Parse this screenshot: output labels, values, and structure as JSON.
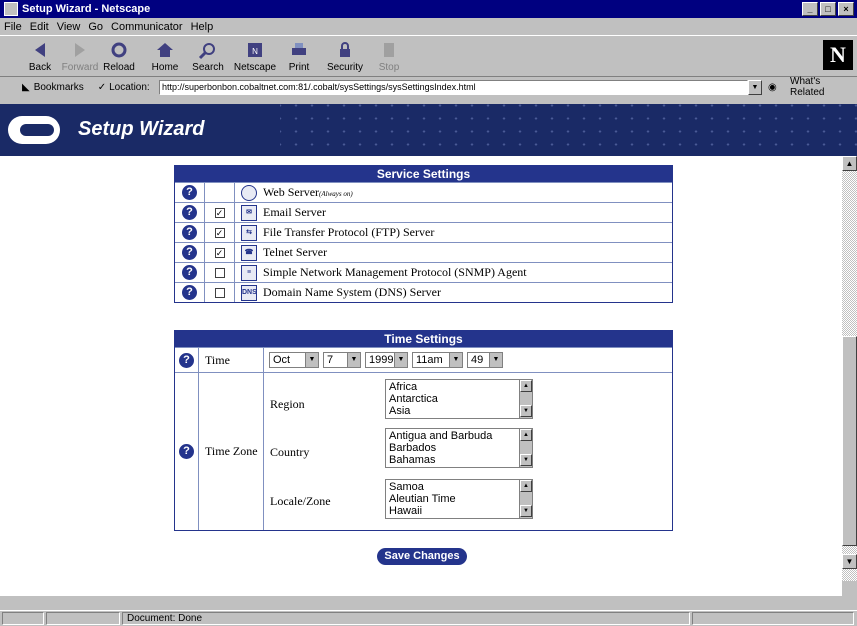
{
  "window": {
    "title": "Setup Wizard - Netscape"
  },
  "menu": [
    "File",
    "Edit",
    "View",
    "Go",
    "Communicator",
    "Help"
  ],
  "toolbar": [
    {
      "label": "Back",
      "icon": "back-arrow-icon",
      "enabled": true
    },
    {
      "label": "Forward",
      "icon": "forward-arrow-icon",
      "enabled": false
    },
    {
      "label": "Reload",
      "icon": "reload-icon",
      "enabled": true
    },
    {
      "label": "Home",
      "icon": "home-icon",
      "enabled": true
    },
    {
      "label": "Search",
      "icon": "search-icon",
      "enabled": true
    },
    {
      "label": "Netscape",
      "icon": "netscape-icon",
      "enabled": true
    },
    {
      "label": "Print",
      "icon": "print-icon",
      "enabled": true
    },
    {
      "label": "Security",
      "icon": "lock-icon",
      "enabled": true
    },
    {
      "label": "Stop",
      "icon": "stop-icon",
      "enabled": false
    }
  ],
  "location": {
    "bookmarks_label": "Bookmarks",
    "location_label": "Location:",
    "url": "http://superbonbon.cobaltnet.com:81/.cobalt/sysSettings/sysSettingsIndex.html",
    "related_label": "What's Related"
  },
  "banner": {
    "title": "Setup Wizard"
  },
  "service": {
    "header": "Service Settings",
    "rows": [
      {
        "label": "Web Server",
        "note": "(Always on)",
        "checkbox": false,
        "checked": null,
        "icon": "globe-icon"
      },
      {
        "label": "Email Server",
        "checkbox": true,
        "checked": true,
        "icon": "envelope-icon"
      },
      {
        "label": "File Transfer Protocol (FTP) Server",
        "checkbox": true,
        "checked": true,
        "icon": "ftp-icon"
      },
      {
        "label": "Telnet Server",
        "checkbox": true,
        "checked": true,
        "icon": "telnet-icon"
      },
      {
        "label": "Simple Network Management Protocol (SNMP) Agent",
        "checkbox": true,
        "checked": false,
        "icon": "snmp-icon"
      },
      {
        "label": "Domain Name System (DNS) Server",
        "checkbox": true,
        "checked": false,
        "icon": "dns-icon",
        "icon_text": "DNS"
      }
    ]
  },
  "time": {
    "header": "Time Settings",
    "time_label": "Time",
    "month": "Oct",
    "day": "7",
    "year": "1999",
    "hour": "11am",
    "minute": "49",
    "timezone_label": "Time Zone",
    "region_label": "Region",
    "region_options": [
      "Africa",
      "Antarctica",
      "Asia"
    ],
    "country_label": "Country",
    "country_options": [
      "Antigua and Barbuda",
      "Barbados",
      "Bahamas"
    ],
    "locale_label": "Locale/Zone",
    "locale_options": [
      "Samoa",
      "Aleutian Time",
      "Hawaii"
    ]
  },
  "save_label": "Save Changes",
  "status": {
    "text": "Document: Done"
  },
  "colors": {
    "accent": "#24348c",
    "banner": "#1a2a66",
    "titlebar": "#000080"
  }
}
